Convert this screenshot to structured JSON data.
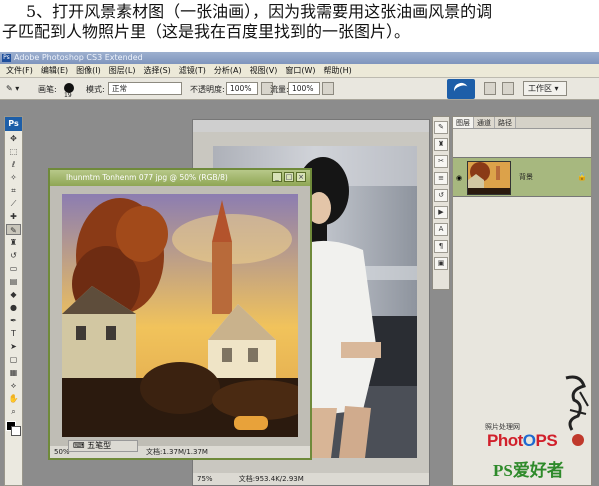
{
  "caption": {
    "line1": "5、打开风景素材图（一张油画），因为我需要用这张油画风景的调",
    "line2": "子匹配到人物照片里（这是我在百度里找到的一张图片）。"
  },
  "app": {
    "title": "Adobe Photoshop CS3 Extended",
    "menu": [
      "文件(F)",
      "编辑(E)",
      "图像(I)",
      "图层(L)",
      "选择(S)",
      "滤镜(T)",
      "分析(A)",
      "视图(V)",
      "窗口(W)",
      "帮助(H)"
    ]
  },
  "options": {
    "brush_label": "画笔:",
    "brush_size": "19",
    "mode_label": "模式:",
    "mode_value": "正常",
    "opacity_label": "不透明度:",
    "opacity_value": "100%",
    "flow_label": "流量:",
    "flow_value": "100%",
    "workspace_label": "工作区 ▾"
  },
  "toolbox": {
    "header": "Ps",
    "tools": [
      "move-tool",
      "marquee-tool",
      "lasso-tool",
      "magic-wand-tool",
      "crop-tool",
      "slice-tool",
      "healing-tool",
      "brush-tool",
      "stamp-tool",
      "history-brush-tool",
      "eraser-tool",
      "gradient-tool",
      "blur-tool",
      "dodge-tool",
      "pen-tool",
      "type-tool",
      "path-select-tool",
      "shape-tool",
      "notes-tool",
      "eyedropper-tool",
      "hand-tool",
      "zoom-tool"
    ]
  },
  "doc_landscape": {
    "title": "Ihunmtm Tonhenm 077 jpg @ 50% (RGB/8)",
    "zoom": "50%",
    "status": "文档:1.37M/1.37M"
  },
  "doc_portrait": {
    "zoom": "75%",
    "status": "文档:953.4K/2.93M"
  },
  "layers_panel": {
    "tabs": [
      "图层",
      "通道",
      "路径"
    ],
    "layer_name": "背景",
    "lock_icon": "lock-icon"
  },
  "taskbar": {
    "label": "五笔型"
  },
  "watermark": {
    "site_label": "照片处理网",
    "photops": "PhotOPS",
    "pssite": "PS爱好者"
  },
  "colors": {
    "ps_blue": "#1d5ea8",
    "active_title": "#8fa654",
    "layer_selected": "#a7b87f",
    "workspace_bg": "#8c8c8c"
  }
}
